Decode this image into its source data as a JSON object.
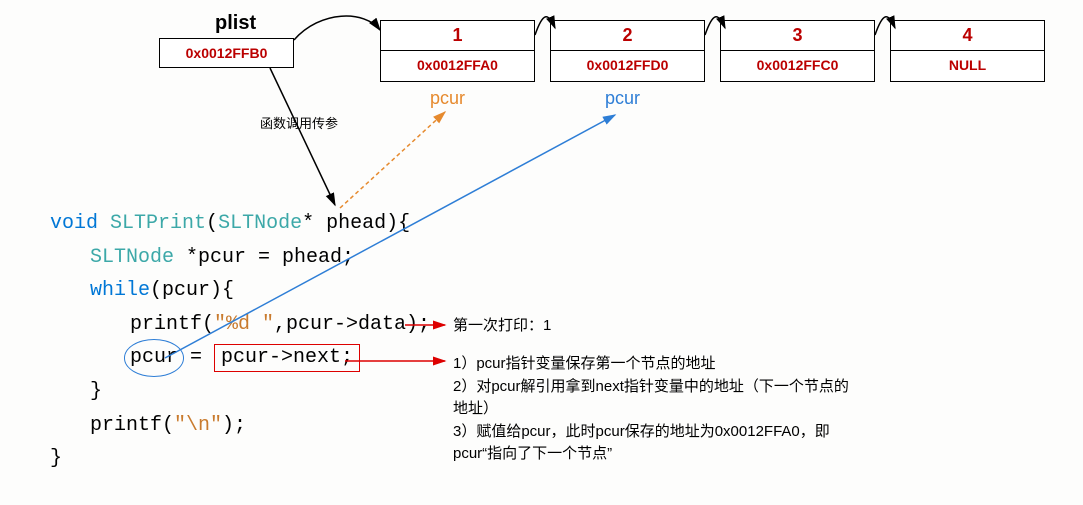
{
  "plist": {
    "label": "plist",
    "address": "0x0012FFB0"
  },
  "nodes": [
    {
      "value": "1",
      "next": "0x0012FFA0"
    },
    {
      "value": "2",
      "next": "0x0012FFD0"
    },
    {
      "value": "3",
      "next": "0x0012FFC0"
    },
    {
      "value": "4",
      "next": "NULL"
    }
  ],
  "labels": {
    "pcur_orange": "pcur",
    "pcur_blue": "pcur",
    "call_param": "函数调用传参"
  },
  "code": {
    "kw_void": "void",
    "fn_name": "SLTPrint",
    "type1": "SLTNode",
    "star_phead": "* phead){",
    "type2": "SLTNode",
    "line2_rest": " *pcur = phead;",
    "kw_while": "while",
    "while_cond": "(pcur){",
    "printf1_pre": "printf(",
    "printf1_fmt": "\"%d \"",
    "printf1_post": ",pcur->data);",
    "assign_lhs": "pcur",
    "assign_eq": " = ",
    "assign_rhs": "pcur->next;",
    "close1": "}",
    "printf2_pre": "printf(",
    "printf2_fmt": "\"\\n\"",
    "printf2_post": ");",
    "close2": "}"
  },
  "notes": {
    "first_print": "第一次打印：1",
    "exp1": "1）pcur指针变量保存第一个节点的地址",
    "exp2": "2）对pcur解引用拿到next指针变量中的地址（下一个节点的地址）",
    "exp3": "3）赋值给pcur，此时pcur保存的地址为0x0012FFA0，即pcur“指向了下一个节点”"
  }
}
